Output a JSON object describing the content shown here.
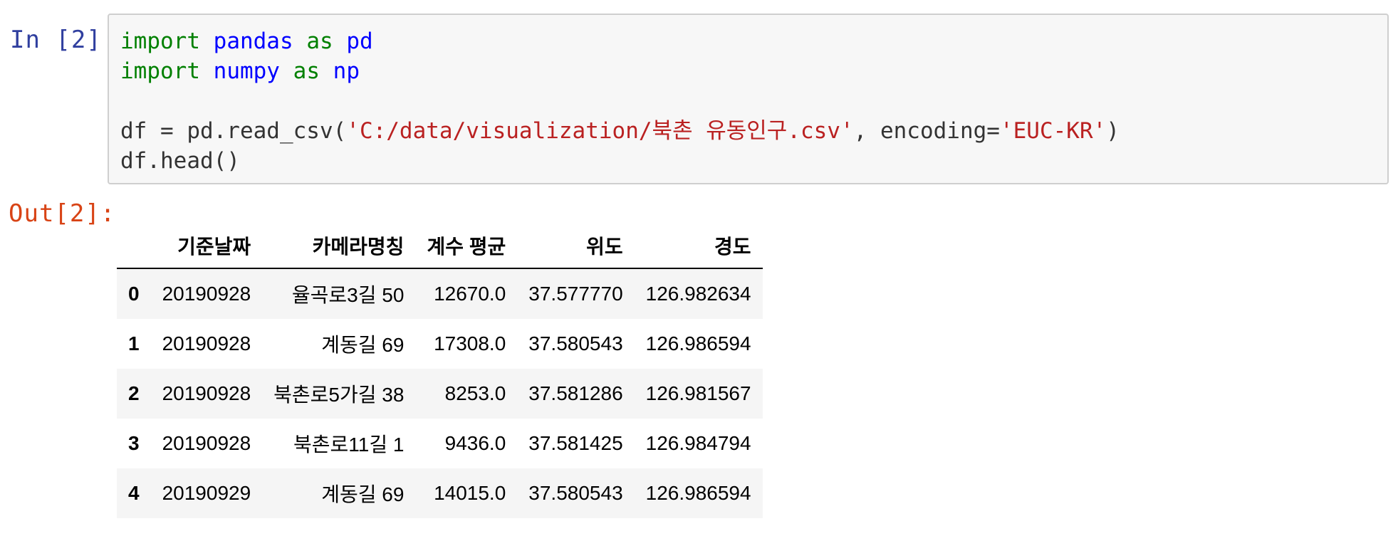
{
  "input_prompt": "In [2]:",
  "output_prompt": "Out[2]:",
  "code": {
    "line1": {
      "kw1": "import",
      "mod": "pandas",
      "kw2": "as",
      "alias": "pd"
    },
    "line2": {
      "kw1": "import",
      "mod": "numpy",
      "kw2": "as",
      "alias": "np"
    },
    "line3": {
      "pre": "df = pd.read_csv(",
      "path": "'C:/data/visualization/북촌 유동인구.csv'",
      "mid": ", encoding=",
      "enc": "'EUC-KR'",
      "post": ")"
    },
    "line4": "df.head()"
  },
  "table": {
    "columns": [
      "",
      "기준날짜",
      "카메라명칭",
      "계수 평균",
      "위도",
      "경도"
    ],
    "rows": [
      [
        "0",
        "20190928",
        "율곡로3길 50",
        "12670.0",
        "37.577770",
        "126.982634"
      ],
      [
        "1",
        "20190928",
        "계동길 69",
        "17308.0",
        "37.580543",
        "126.986594"
      ],
      [
        "2",
        "20190928",
        "북촌로5가길 38",
        "8253.0",
        "37.581286",
        "126.981567"
      ],
      [
        "3",
        "20190928",
        "북촌로11길 1",
        "9436.0",
        "37.581425",
        "126.984794"
      ],
      [
        "4",
        "20190929",
        "계동길 69",
        "14015.0",
        "37.580543",
        "126.986594"
      ]
    ]
  }
}
